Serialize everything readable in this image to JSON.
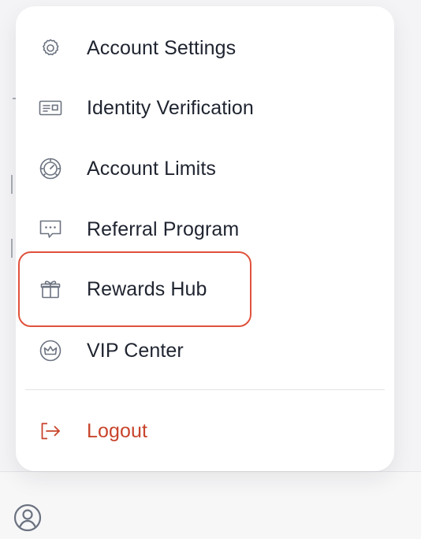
{
  "menu": {
    "items": [
      {
        "label": "Account Settings",
        "icon": "gear-icon"
      },
      {
        "label": "Identity Verification",
        "icon": "id-card-icon"
      },
      {
        "label": "Account Limits",
        "icon": "gauge-icon"
      },
      {
        "label": "Referral Program",
        "icon": "chat-bubble-icon"
      },
      {
        "label": "Rewards Hub",
        "icon": "gift-icon",
        "highlighted": true
      },
      {
        "label": "VIP Center",
        "icon": "crown-icon"
      }
    ],
    "logout": {
      "label": "Logout",
      "icon": "logout-icon"
    }
  },
  "colors": {
    "text": "#1f2430",
    "icon": "#6b7280",
    "logout": "#c8442b",
    "highlight_border": "#e0523c",
    "panel_bg": "#ffffff",
    "page_bg": "#f4f4f6"
  },
  "profile": {
    "icon": "user-circle-icon"
  }
}
